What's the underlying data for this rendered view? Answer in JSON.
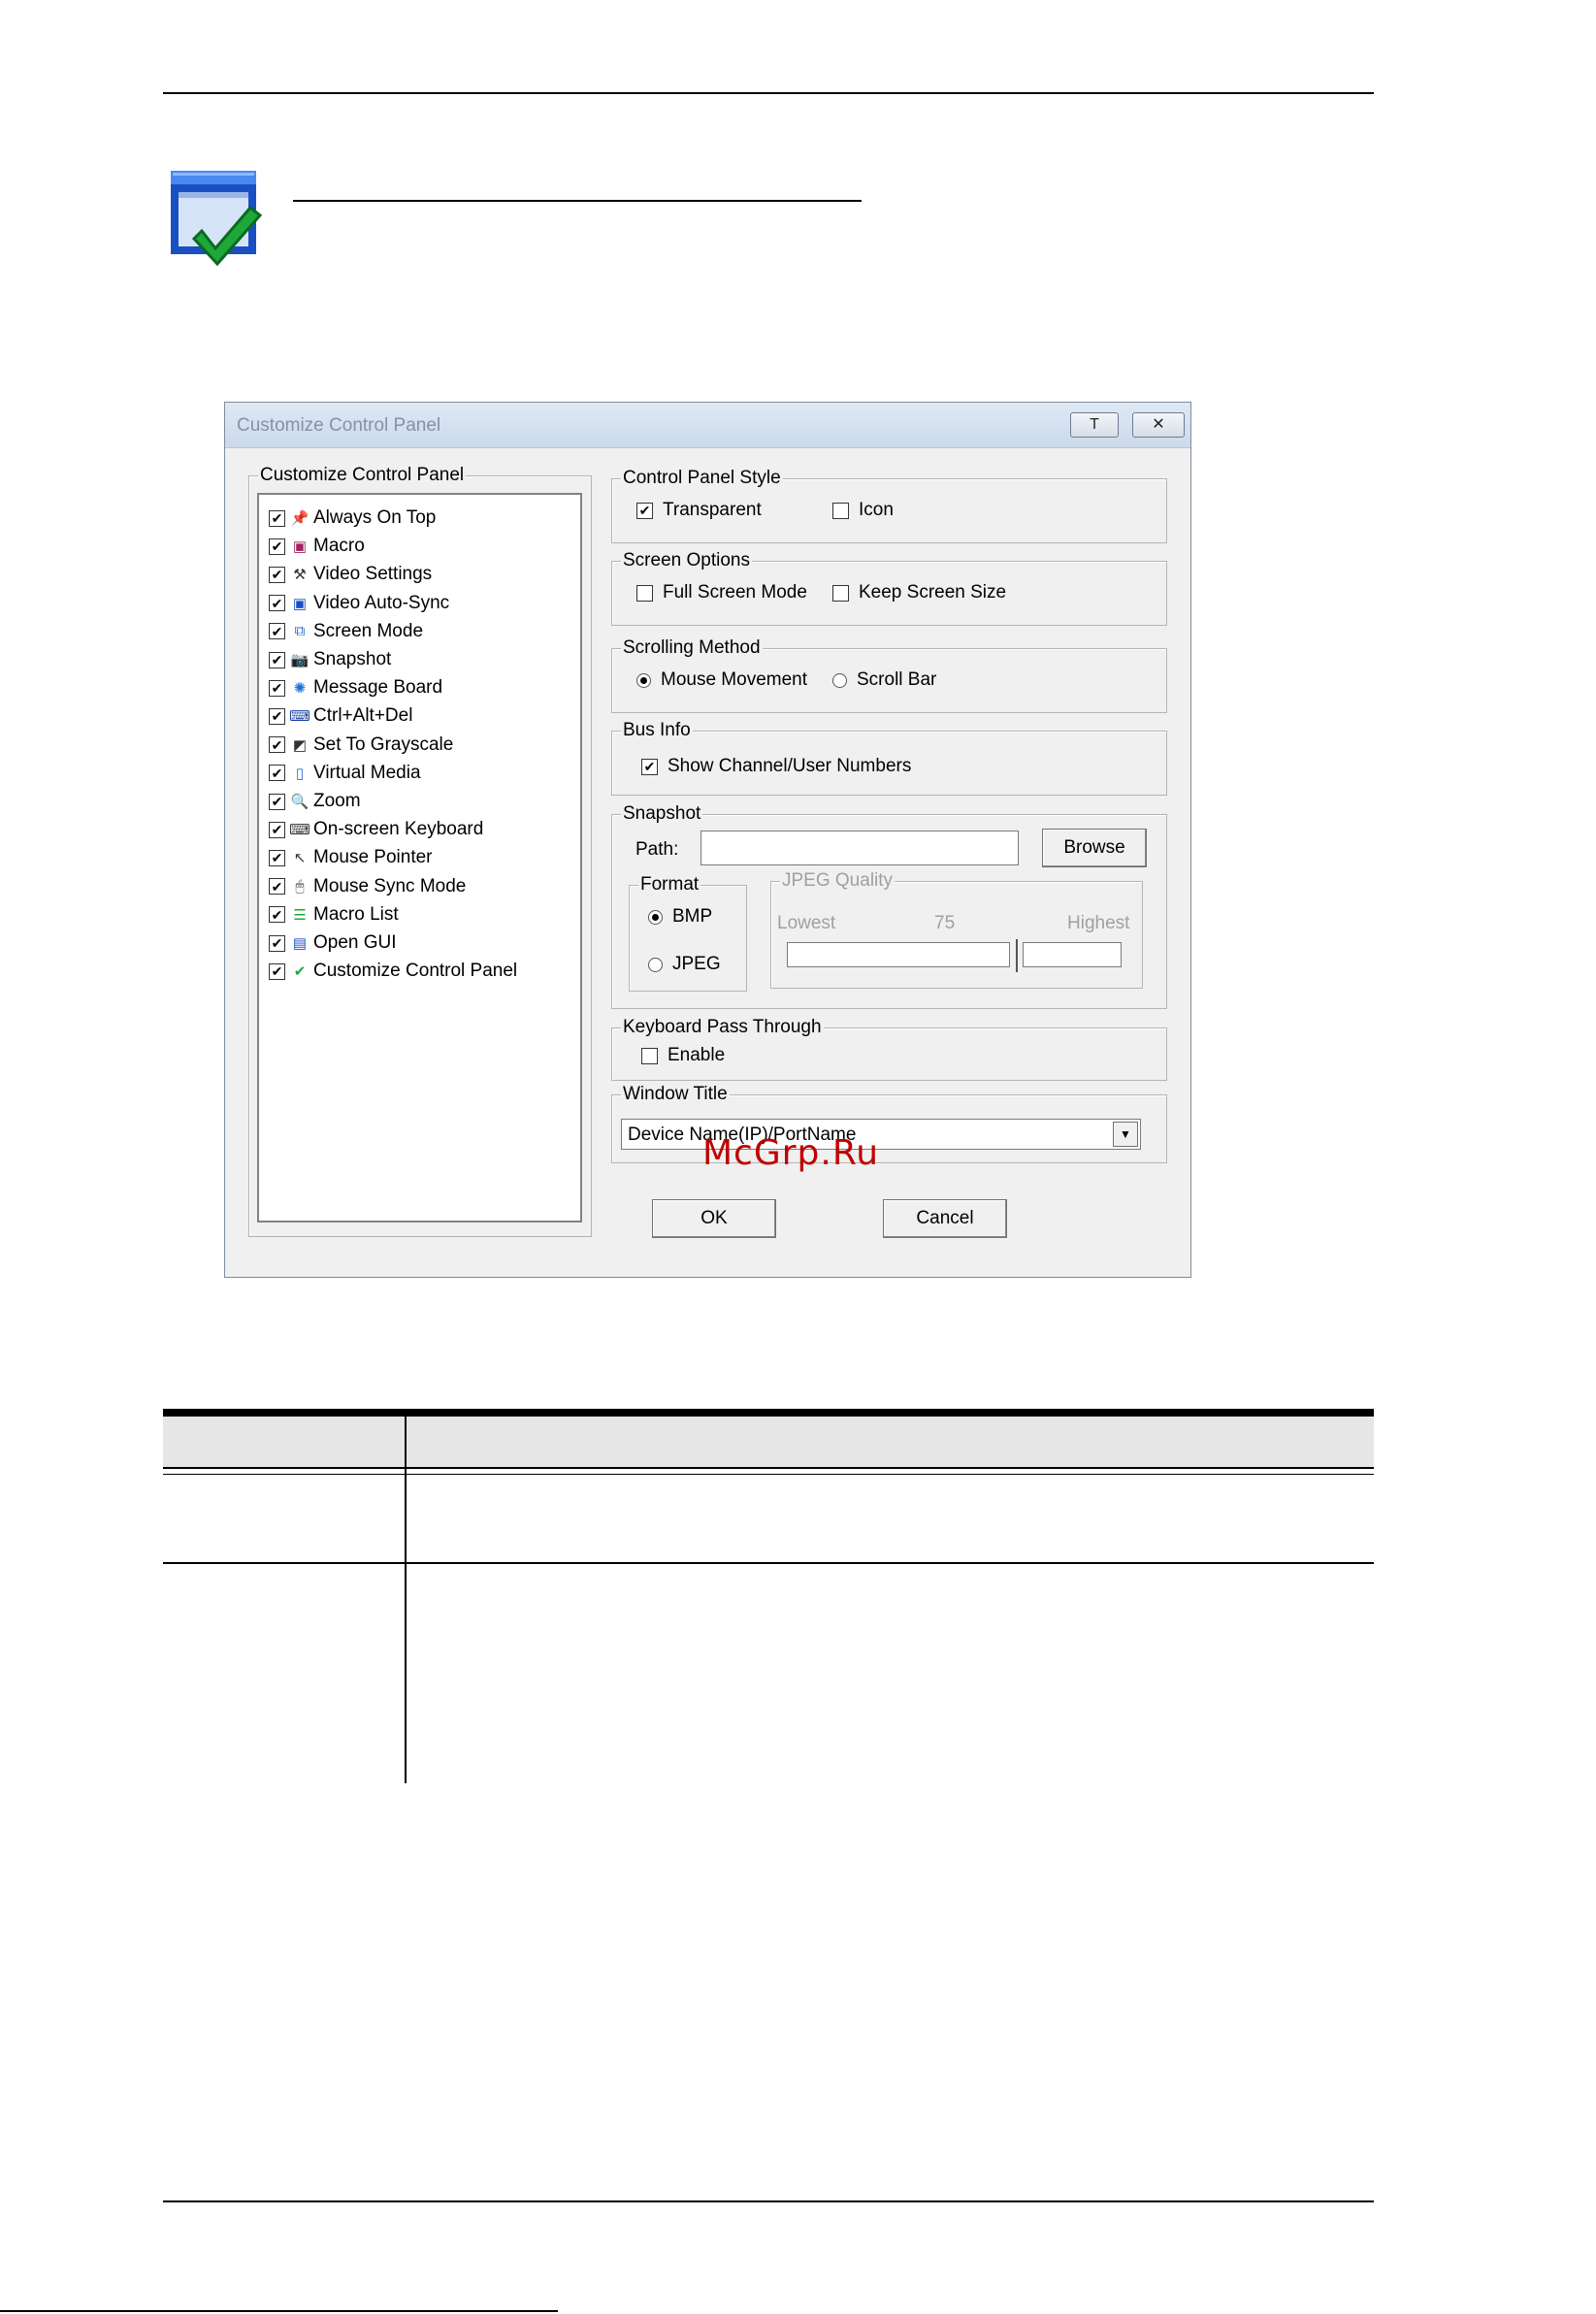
{
  "dialog": {
    "title": "Customize Control Panel",
    "pin_button": "T",
    "close_button": "✕",
    "list_group_label": "Customize Control Panel",
    "items": [
      {
        "label": "Always On Top",
        "checked": true,
        "icon": "pin-icon"
      },
      {
        "label": "Macro",
        "checked": true,
        "icon": "macro-icon"
      },
      {
        "label": "Video Settings",
        "checked": true,
        "icon": "hammer-icon"
      },
      {
        "label": "Video Auto-Sync",
        "checked": true,
        "icon": "monitor-icon"
      },
      {
        "label": "Screen Mode",
        "checked": true,
        "icon": "screen-mode-icon"
      },
      {
        "label": "Snapshot",
        "checked": true,
        "icon": "camera-icon"
      },
      {
        "label": "Message Board",
        "checked": true,
        "icon": "message-board-icon"
      },
      {
        "label": "Ctrl+Alt+Del",
        "checked": true,
        "icon": "ctrl-alt-del-icon"
      },
      {
        "label": "Set To Grayscale",
        "checked": true,
        "icon": "grayscale-icon"
      },
      {
        "label": "Virtual Media",
        "checked": true,
        "icon": "usb-drive-icon"
      },
      {
        "label": "Zoom",
        "checked": true,
        "icon": "magnifier-icon"
      },
      {
        "label": "On-screen Keyboard",
        "checked": true,
        "icon": "keyboard-icon"
      },
      {
        "label": "Mouse Pointer",
        "checked": true,
        "icon": "pointer-icon"
      },
      {
        "label": "Mouse Sync Mode",
        "checked": true,
        "icon": "mouse-icon"
      },
      {
        "label": "Macro List",
        "checked": true,
        "icon": "macro-list-icon"
      },
      {
        "label": "Open GUI",
        "checked": true,
        "icon": "gui-icon"
      },
      {
        "label": "Customize Control Panel",
        "checked": true,
        "icon": "customize-icon"
      }
    ],
    "control_panel_style": {
      "label": "Control Panel Style",
      "transparent": "Transparent",
      "icon": "Icon"
    },
    "screen_options": {
      "label": "Screen Options",
      "full_screen": "Full Screen Mode",
      "keep_size": "Keep Screen Size"
    },
    "scrolling_method": {
      "label": "Scrolling Method",
      "mouse_movement": "Mouse Movement",
      "scroll_bar": "Scroll Bar",
      "selected": "Mouse Movement"
    },
    "bus_info": {
      "label": "Bus Info",
      "show_numbers": "Show Channel/User Numbers"
    },
    "snapshot": {
      "label": "Snapshot",
      "path_label": "Path:",
      "path_value": "",
      "browse": "Browse",
      "format_label": "Format",
      "bmp": "BMP",
      "jpeg": "JPEG",
      "selected_format": "BMP",
      "jpeg_quality_label": "JPEG Quality",
      "lowest": "Lowest",
      "quality_value": "75",
      "highest": "Highest",
      "quality_level": 0.75
    },
    "keyboard_pass_through": {
      "label": "Keyboard Pass Through",
      "enable": "Enable"
    },
    "window_title": {
      "label": "Window Title",
      "selected": "Device Name(IP)/PortName"
    },
    "ok": "OK",
    "cancel": "Cancel"
  },
  "watermark": "McGrp.Ru"
}
